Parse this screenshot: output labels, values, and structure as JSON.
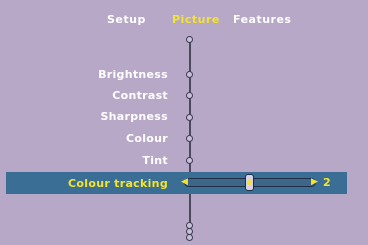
{
  "tabs": [
    {
      "label": "Setup",
      "active": false
    },
    {
      "label": "Picture",
      "active": true
    },
    {
      "label": "Features",
      "active": false
    }
  ],
  "menu": {
    "items": [
      "Brightness",
      "Contrast",
      "Sharpness",
      "Colour",
      "Tint"
    ],
    "selected": {
      "label": "Colour tracking",
      "value": "2"
    }
  },
  "colors": {
    "background": "#b7a8c8",
    "highlight": "#3b6e95",
    "active_text": "#f5e52a",
    "text": "#ffffff"
  },
  "slider": {
    "left_icon": "left-arrow-icon",
    "right_icon": "right-arrow-icon",
    "thumb_icon": "slider-thumb-icon"
  }
}
